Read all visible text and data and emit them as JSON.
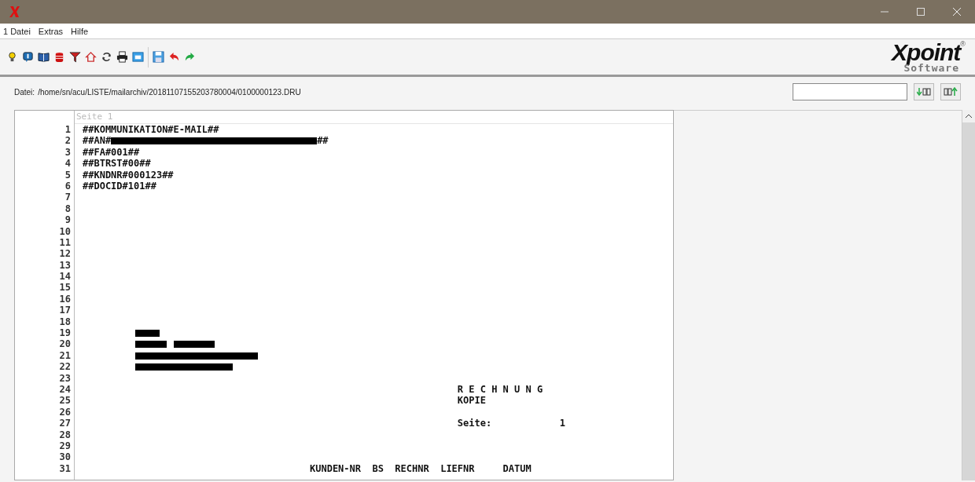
{
  "menu": [
    {
      "label": "1 Datei"
    },
    {
      "label": "Extras"
    },
    {
      "label": "Hilfe"
    }
  ],
  "logo": {
    "brand": "Xpoint",
    "sub": "Software",
    "mark": "®"
  },
  "path_bar": {
    "label": "Datei:",
    "path": "/home/sn/acu/LISTE/mailarchiv/20181107155203780004/0100000123.DRU"
  },
  "document": {
    "page_label": "Seite 1",
    "lines": [
      {
        "n": "1",
        "segments": [
          {
            "kind": "text",
            "text": "##KOMMUNIKATION#E-MAIL##"
          }
        ]
      },
      {
        "n": "2",
        "segments": [
          {
            "kind": "text",
            "text": "##AN#"
          },
          {
            "kind": "redacted"
          },
          {
            "kind": "text",
            "text": "##"
          }
        ]
      },
      {
        "n": "3",
        "segments": [
          {
            "kind": "text",
            "text": "##FA#001##"
          }
        ]
      },
      {
        "n": "4",
        "segments": [
          {
            "kind": "text",
            "text": "##BTRST#00##"
          }
        ]
      },
      {
        "n": "5",
        "segments": [
          {
            "kind": "text",
            "text": "##KNDNR#000123##"
          }
        ]
      },
      {
        "n": "6",
        "segments": [
          {
            "kind": "text",
            "text": "##DOCID#101##"
          }
        ]
      },
      {
        "n": "7"
      },
      {
        "n": "8"
      },
      {
        "n": "9"
      },
      {
        "n": "10"
      },
      {
        "n": "11"
      },
      {
        "n": "12"
      },
      {
        "n": "13"
      },
      {
        "n": "14"
      },
      {
        "n": "15"
      },
      {
        "n": "16"
      },
      {
        "n": "17"
      },
      {
        "n": "18"
      },
      {
        "n": "19",
        "segments": [
          {
            "kind": "redacted"
          }
        ]
      },
      {
        "n": "20",
        "segments": [
          {
            "kind": "redacted"
          },
          {
            "kind": "redacted"
          }
        ]
      },
      {
        "n": "21",
        "segments": [
          {
            "kind": "redacted"
          }
        ]
      },
      {
        "n": "22",
        "segments": [
          {
            "kind": "redacted"
          }
        ]
      },
      {
        "n": "23"
      },
      {
        "n": "24",
        "segments": [
          {
            "kind": "text",
            "text": "                                                                  R E C H N U N G"
          }
        ]
      },
      {
        "n": "25",
        "segments": [
          {
            "kind": "text",
            "text": "                                                                  KOPIE"
          }
        ]
      },
      {
        "n": "26"
      },
      {
        "n": "27",
        "segments": [
          {
            "kind": "text",
            "text": "                                                                  Seite:            1"
          }
        ]
      },
      {
        "n": "28"
      },
      {
        "n": "29"
      },
      {
        "n": "30"
      },
      {
        "n": "31",
        "segments": [
          {
            "kind": "text",
            "text": "                                        KUNDEN-NR  BS  RECHNR  LIEFNR     DATUM"
          }
        ]
      }
    ]
  }
}
